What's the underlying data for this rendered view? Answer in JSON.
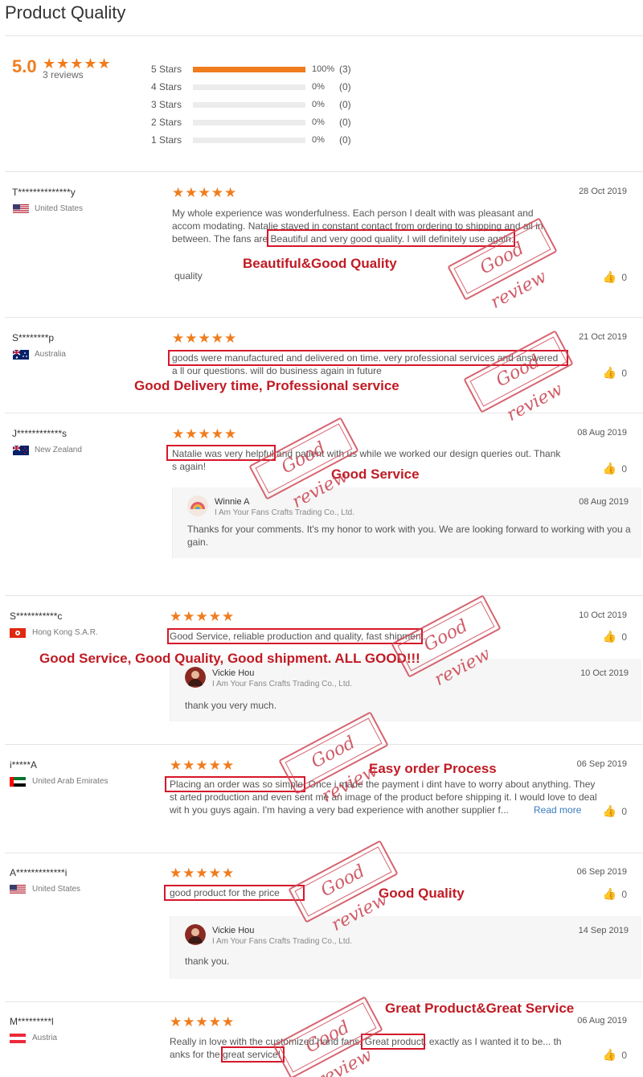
{
  "header": {
    "title": "Product Quality"
  },
  "summary": {
    "average": "5.0",
    "stars": "★★★★★",
    "review_count": "3 reviews",
    "distribution": [
      {
        "label": "5 Stars",
        "percent_text": "100%",
        "count": "(3)",
        "fraction": 1.0
      },
      {
        "label": "4 Stars",
        "percent_text": "0%",
        "count": "(0)",
        "fraction": 0
      },
      {
        "label": "3 Stars",
        "percent_text": "0%",
        "count": "(0)",
        "fraction": 0
      },
      {
        "label": "2 Stars",
        "percent_text": "0%",
        "count": "(0)",
        "fraction": 0
      },
      {
        "label": "1 Stars",
        "percent_text": "0%",
        "count": "(0)",
        "fraction": 0
      }
    ]
  },
  "colors": {
    "accent": "#f07c1d",
    "annotation": "#c01b24",
    "link": "#3a7bbf"
  },
  "reviews": [
    {
      "name": "T**************y",
      "country": "United States",
      "stars": "★★★★★",
      "date": "28 Oct 2019",
      "text": "My whole experience was wonderfulness. Each person I dealt with was pleasant and accom modating. Natalie stayed in constant contact from ordering to shipping and all in between. The fans are Beautiful and very good quality. I will definitely use again.",
      "tag": "quality",
      "likes": "0"
    },
    {
      "name": "S********p",
      "country": "Australia",
      "stars": "★★★★★",
      "date": "21 Oct 2019",
      "text": "goods were manufactured and delivered on time. very professional services and answered a ll our questions. will do business again in future",
      "likes": "0"
    },
    {
      "name": "J************s",
      "country": "New Zealand",
      "stars": "★★★★★",
      "date": "08 Aug 2019",
      "text": "Natalie was very helpful and patient with us while we worked our design queries out. Thank s again!",
      "likes": "0",
      "reply": {
        "name": "Winnie A",
        "company": "I Am Your Fans Crafts Trading Co., Ltd.",
        "date": "08 Aug 2019",
        "text": "Thanks for your comments. It's my honor to work with you. We are looking forward to working with you a gain."
      }
    },
    {
      "name": "S***********c",
      "country": "Hong Kong S.A.R.",
      "stars": "★★★★★",
      "date": "10 Oct 2019",
      "text": "Good Service, reliable production and quality, fast shipment.",
      "likes": "0",
      "reply": {
        "name": "Vickie Hou",
        "company": "I Am Your Fans Crafts Trading Co., Ltd.",
        "date": "10 Oct 2019",
        "text": "thank you very much."
      }
    },
    {
      "name": "i*****A",
      "country": "United Arab Emirates",
      "stars": "★★★★★",
      "date": "06 Sep 2019",
      "text": "Placing an order was so simple. Once i made the payment i dint have to worry about anything. They st arted production and even sent me an image of the product before shipping it. I would love to deal wit h you guys again. I'm having a very bad experience with another supplier f...",
      "read_more": "Read more",
      "likes": "0"
    },
    {
      "name": "A*************i",
      "country": "United States",
      "stars": "★★★★★",
      "date": "06 Sep 2019",
      "text": "good product for the price",
      "likes": "0",
      "reply": {
        "name": "Vickie Hou",
        "company": "I Am Your Fans Crafts Trading Co., Ltd.",
        "date": "14 Sep 2019",
        "text": "thank you."
      }
    },
    {
      "name": "M*********l",
      "country": "Austria",
      "stars": "★★★★★",
      "date": "06 Aug 2019",
      "text": "Really in love with the customized hand fans. Great product, exactly as I wanted it to be... th anks for the great service!",
      "likes": "0"
    }
  ],
  "annotations": {
    "a1": "Beautiful&Good Quality",
    "a2": "Good Delivery time, Professional service",
    "a3": "Good Service",
    "a4": "Good Service, Good Quality, Good shipment. ALL GOOD!!!",
    "a5": "Easy order Process",
    "a6": "Good Quality",
    "a7": "Great Product&Great Service",
    "stamp": "Good review"
  }
}
